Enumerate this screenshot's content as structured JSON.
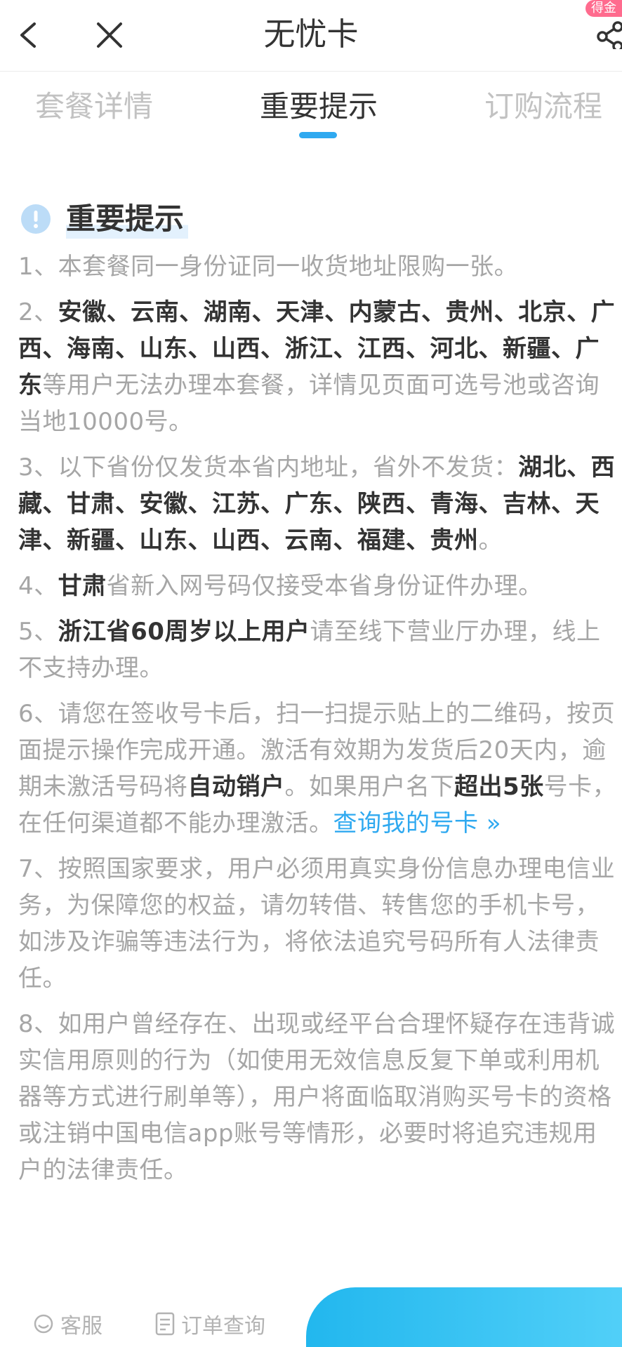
{
  "header": {
    "title": "无忧卡",
    "reward_badge": "得金"
  },
  "tabs": [
    {
      "label": "套餐详情"
    },
    {
      "label": "重要提示"
    },
    {
      "label": "订购流程"
    }
  ],
  "section": {
    "title": "重要提示"
  },
  "notices": {
    "n1": {
      "text": "1、本套餐同一身份证同一收货地址限购一张。"
    },
    "n2": {
      "prefix": "2、",
      "bold": "安徽、云南、湖南、天津、内蒙古、贵州、北京、广西、海南、山东、山西、浙江、江西、河北、新疆、广东",
      "suffix": "等用户无法办理本套餐，详情见页面可选号池或咨询当地10000号。"
    },
    "n3": {
      "prefix": "3、以下省份仅发货本省内地址，省外不发货：",
      "bold": "湖北、西藏、甘肃、安徽、江苏、广东、陕西、青海、吉林、天津、新疆、山东、山西、云南、福建、贵州",
      "suffix": "。"
    },
    "n4": {
      "prefix": "4、",
      "bold": "甘肃",
      "suffix": "省新入网号码仅接受本省身份证件办理。"
    },
    "n5": {
      "prefix": "5、",
      "bold": "浙江省60周岁以上用户",
      "suffix": "请至线下营业厅办理，线上不支持办理。"
    },
    "n6": {
      "prefix": "6、请您在签收号卡后，扫一扫提示贴上的二维码，按页面提示操作完成开通。激活有效期为发货后20天内，逾期未激活号码将",
      "bold1": "自动销户",
      "mid": "。如果用户名下",
      "bold2": "超出5张",
      "suffix": "号卡，在任何渠道都不能办理激活。",
      "link": "查询我的号卡 »"
    },
    "n7": {
      "text": "7、按照国家要求，用户必须用真实身份信息办理电信业务，为保障您的权益，请勿转借、转售您的手机卡号，如涉及诈骗等违法行为，将依法追究号码所有人法律责任。"
    },
    "n8": {
      "text": "8、如用户曾经存在、出现或经平台合理怀疑存在违背诚实信用原则的行为（如使用无效信息反复下单或利用机器等方式进行刷单等），用户将面临取消购买号卡的资格或注销中国电信app账号等情形，必要时将追究违规用户的法律责任。"
    }
  },
  "bottom_bar": {
    "service_label": "客服",
    "order_query_label": "订单查询"
  },
  "colors": {
    "accent": "#2fa9f0",
    "inactive_tab": "#c2c2c2",
    "muted_text": "#a6a6a6",
    "strong_text": "#333333"
  }
}
